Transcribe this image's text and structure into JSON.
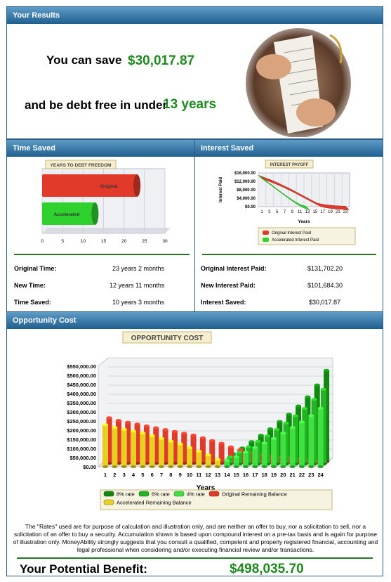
{
  "results": {
    "header": "Your Results",
    "save_prefix": "You can save",
    "save_amount": "$30,017.87",
    "debt_prefix": "and be debt free in under",
    "debt_years": "13 years",
    "photo_icon": "receipt-photo"
  },
  "time_saved": {
    "header": "Time Saved",
    "chart_data": {
      "type": "bar",
      "title": "YEARS TO DEBT FREEDOM",
      "categories": [
        "Original",
        "Accelerated"
      ],
      "values": [
        23.17,
        12.92
      ],
      "xlim": [
        0,
        30
      ],
      "xticks": [
        "0",
        "5",
        "10",
        "15",
        "20",
        "25",
        "30"
      ],
      "colors": [
        "#e23a2a",
        "#2fd12f"
      ]
    },
    "rows": [
      {
        "label": "Original Time:",
        "value": "23 years 2 months"
      },
      {
        "label": "New Time:",
        "value": "12 years 11 months"
      },
      {
        "label": "Time Saved:",
        "value": "10 years 3 months"
      }
    ]
  },
  "interest_saved": {
    "header": "Interest Saved",
    "chart_data": {
      "type": "line",
      "title": "INTEREST PAYOFF",
      "ylabel": "Interest Paid",
      "xlabel": "Years",
      "yticks": [
        "$16,000.00",
        "$12,000.00",
        "$8,000.00",
        "$4,000.00",
        "$0.00"
      ],
      "ylim": [
        0,
        16000
      ],
      "xticks": [
        "1",
        "3",
        "5",
        "7",
        "9",
        "11",
        "13",
        "15",
        "17",
        "19",
        "21",
        "23"
      ],
      "series": [
        {
          "name": "Original Interest Paid",
          "color": "#e23a2a",
          "values": [
            14900,
            14200,
            13500,
            12800,
            12000,
            11200,
            10300,
            9400,
            8500,
            7500,
            6500,
            5500,
            4500,
            3500,
            2500,
            1600,
            1200,
            900,
            700,
            500,
            400,
            300,
            200
          ]
        },
        {
          "name": "Accelerated Interest Paid",
          "color": "#2fd12f",
          "values": [
            14900,
            13600,
            12200,
            10800,
            9400,
            8000,
            6600,
            5200,
            3900,
            2700,
            1600,
            700,
            200
          ]
        }
      ]
    },
    "rows": [
      {
        "label": "Original Interest Paid:",
        "value": "$131,702.20"
      },
      {
        "label": "New Interest Paid:",
        "value": "$101,684.30"
      },
      {
        "label": "Interest Saved:",
        "value": "$30,017.87"
      }
    ]
  },
  "opportunity": {
    "header": "Opportunity Cost",
    "chart_data": {
      "type": "bar",
      "title": "OPPORTUNITY COST",
      "xlabel": "Years",
      "ylim": [
        0,
        550000
      ],
      "yticks": [
        "$550,000.00",
        "$500,000.00",
        "$450,000.00",
        "$400,000.00",
        "$350,000.00",
        "$300,000.00",
        "$250,000.00",
        "$200,000.00",
        "$150,000.00",
        "$100,000.00",
        "$50,000.00",
        "$0.00"
      ],
      "categories": [
        "1",
        "2",
        "3",
        "4",
        "5",
        "6",
        "7",
        "8",
        "9",
        "10",
        "11",
        "12",
        "13",
        "14",
        "15",
        "16",
        "17",
        "18",
        "19",
        "20",
        "21",
        "22",
        "23",
        "24"
      ],
      "series": [
        {
          "name": "8% rate",
          "color": "#0f8a0f",
          "values": [
            0,
            0,
            0,
            0,
            0,
            0,
            0,
            0,
            0,
            0,
            0,
            0,
            0,
            45000,
            75000,
            110000,
            145000,
            180000,
            220000,
            260000,
            305000,
            355000,
            420000,
            500000
          ]
        },
        {
          "name": "6% rate",
          "color": "#22b422",
          "values": [
            0,
            0,
            0,
            0,
            0,
            0,
            0,
            0,
            0,
            0,
            0,
            0,
            0,
            40000,
            65000,
            95000,
            125000,
            155000,
            190000,
            225000,
            265000,
            305000,
            355000,
            410000
          ]
        },
        {
          "name": "4% rate",
          "color": "#3fe03f",
          "values": [
            0,
            0,
            0,
            0,
            0,
            0,
            0,
            0,
            0,
            0,
            0,
            0,
            0,
            35000,
            55000,
            80000,
            105000,
            130000,
            155000,
            185000,
            215000,
            245000,
            280000,
            320000
          ]
        },
        {
          "name": "Original Remaining Balance",
          "color": "#e03a2a",
          "values": [
            250000,
            235000,
            225000,
            215000,
            205000,
            195000,
            185000,
            175000,
            165000,
            155000,
            140000,
            125000,
            110000,
            90000,
            75000,
            60000,
            50000,
            40000,
            35000,
            30000,
            25000,
            20000,
            15000,
            10000
          ]
        },
        {
          "name": "Accelerated Remaining Balance",
          "color": "#e8d020",
          "values": [
            230000,
            215000,
            205000,
            195000,
            185000,
            170000,
            155000,
            140000,
            125000,
            105000,
            85000,
            65000,
            40000,
            0,
            0,
            0,
            0,
            0,
            0,
            0,
            0,
            0,
            0,
            0
          ]
        }
      ]
    },
    "disclaimer": "The \"Rates\" used are for purpose of calculation and illustration only, and are neither an offer to buy, nor a solicitation to sell, nor a solicitation of an offer to buy a security. Accumulation shown is based upon compound interest on a pre-tax basis and is again for purpose of illustration only. MoneyAbility strongly suggests that you consult a qualified, competent and properly registered financial, accounting and legal professional when considering and/or executing financial review and/or transactions.",
    "benefit_label": "Your Potential Benefit:",
    "benefit_value": "$498,035.70"
  }
}
